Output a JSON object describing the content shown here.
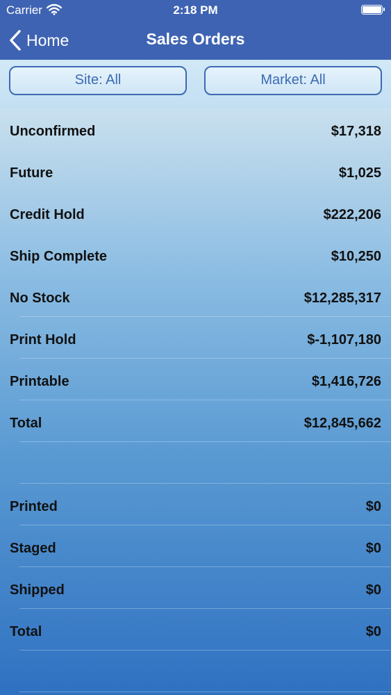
{
  "status_bar": {
    "carrier": "Carrier",
    "time": "2:18 PM"
  },
  "nav": {
    "back_label": "Home",
    "title": "Sales Orders"
  },
  "filters": {
    "site": "Site: All",
    "market": "Market: All"
  },
  "order_groups": [
    {
      "rows": [
        {
          "label": "Unconfirmed",
          "value": "$17,318"
        },
        {
          "label": "Future",
          "value": "$1,025"
        },
        {
          "label": "Credit Hold",
          "value": "$222,206"
        },
        {
          "label": "Ship Complete",
          "value": "$10,250"
        },
        {
          "label": "No Stock",
          "value": "$12,285,317"
        },
        {
          "label": "Print Hold",
          "value": "$-1,107,180"
        },
        {
          "label": "Printable",
          "value": "$1,416,726"
        },
        {
          "label": "Total",
          "value": "$12,845,662"
        }
      ]
    },
    {
      "rows": [
        {
          "label": "Printed",
          "value": "$0"
        },
        {
          "label": "Staged",
          "value": "$0"
        },
        {
          "label": "Shipped",
          "value": "$0"
        },
        {
          "label": "Total",
          "value": "$0"
        }
      ]
    }
  ],
  "colors": {
    "nav_background": "#3f63b3",
    "filter_accent": "#3c6ab3"
  },
  "icons": {
    "wifi": "wifi-icon",
    "battery": "battery-icon",
    "back": "chevron-left-icon"
  }
}
